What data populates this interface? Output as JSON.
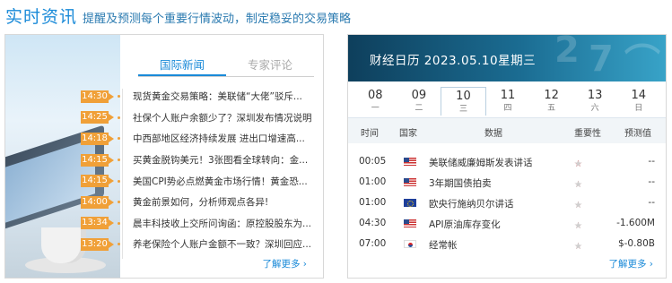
{
  "header": {
    "title": "实时资讯",
    "subtitle": "提醒及预测每个重要行情波动，制定稳妥的交易策略"
  },
  "news": {
    "tabs": [
      "国际新闻",
      "专家评论"
    ],
    "items": [
      {
        "time": "14:30",
        "text": "现货黄金交易策略：美联储“大佬”驳斥..."
      },
      {
        "time": "14:25",
        "text": "社保个人账户余额少了？深圳发布情况说明"
      },
      {
        "time": "14:18",
        "text": "中西部地区经济持续发展 进出口增速高..."
      },
      {
        "time": "14:15",
        "text": "买黄金脱钩美元！3张图看全球转向：金..."
      },
      {
        "time": "14:15",
        "text": "美国CPI势必点燃黄金市场行情！黄金恐..."
      },
      {
        "time": "14:00",
        "text": "黄金前景如何，分析师观点各异!"
      },
      {
        "time": "13:34",
        "text": "晨丰科技收上交所问询函：原控股股东为..."
      },
      {
        "time": "13:20",
        "text": "养老保险个人账户金额不一致？深圳回应..."
      }
    ],
    "more": "了解更多 ›"
  },
  "calendar": {
    "title": "财经日历 2023.05.10星期三",
    "days": [
      {
        "num": "08",
        "wk": "一"
      },
      {
        "num": "09",
        "wk": "二"
      },
      {
        "num": "10",
        "wk": "三"
      },
      {
        "num": "11",
        "wk": "四"
      },
      {
        "num": "12",
        "wk": "五"
      },
      {
        "num": "13",
        "wk": "六"
      },
      {
        "num": "14",
        "wk": "日"
      }
    ],
    "active_day": "10",
    "columns": [
      "时间",
      "国家",
      "数据",
      "重要性",
      "预测值"
    ],
    "rows": [
      {
        "time": "00:05",
        "flag": "us",
        "data": "美联储威廉姆斯发表讲话",
        "stars": 2,
        "forecast": "--"
      },
      {
        "time": "01:00",
        "flag": "us",
        "data": "3年期国债拍卖",
        "stars": 1,
        "forecast": "--"
      },
      {
        "time": "01:00",
        "flag": "eu",
        "data": "欧央行施纳贝尔讲话",
        "stars": 1,
        "forecast": "--"
      },
      {
        "time": "04:30",
        "flag": "us",
        "data": "API原油库存变化",
        "stars": 1,
        "forecast": "-1.600M"
      },
      {
        "time": "07:00",
        "flag": "kr",
        "data": "经常帐",
        "stars": 1,
        "forecast": "$-0.80B"
      }
    ],
    "more": "了解更多 ›",
    "accent": "#1a8ad8",
    "tag_color": "#f0a038"
  }
}
